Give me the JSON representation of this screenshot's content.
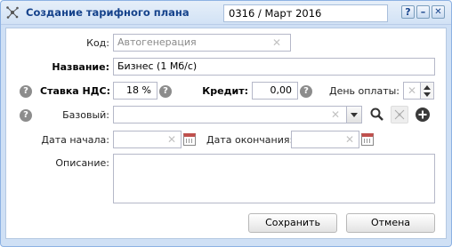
{
  "window": {
    "title": "Создание тарифного плана",
    "period": "0316 / Март 2016",
    "buttons": {
      "help": "?",
      "minimize": "–",
      "close": "✕"
    }
  },
  "form": {
    "code": {
      "label": "Код:",
      "value": "Автогенерация"
    },
    "name": {
      "label": "Название:",
      "value": "Бизнес (1 Мб/с)"
    },
    "vat": {
      "label": "Ставка НДС:",
      "value": "18 %"
    },
    "credit": {
      "label": "Кредит:",
      "value": "0,00"
    },
    "payment_day": {
      "label": "День оплаты:",
      "value": ""
    },
    "base": {
      "label": "Базовый:",
      "value": ""
    },
    "start_date": {
      "label": "Дата начала:",
      "value": ""
    },
    "end_date": {
      "label": "Дата окончания:",
      "value": ""
    },
    "description": {
      "label": "Описание:",
      "value": ""
    }
  },
  "actions": {
    "save": "Сохранить",
    "cancel": "Отмена"
  },
  "icons": {
    "title": "network-icon",
    "search": "search-icon",
    "tree": "tree-icon",
    "add": "add-icon",
    "help": "help-icon",
    "calendar": "calendar-icon"
  }
}
